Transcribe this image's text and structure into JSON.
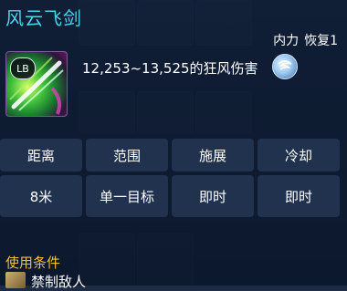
{
  "skill": {
    "name": "风云飞剑",
    "type_label": "内力",
    "recovery_label": "恢复1",
    "key": "LB",
    "icon": "wind-sword-skill-icon",
    "damage_text": "12,253~13,525的狂风伤害",
    "element_icon": "wind-element-icon"
  },
  "stats": {
    "headers": [
      "距离",
      "范围",
      "施展",
      "冷却"
    ],
    "values": [
      "8米",
      "单一目标",
      "即时",
      "即时"
    ]
  },
  "conditions": {
    "title": "使用条件",
    "items": [
      {
        "icon": "condition-icon",
        "text": "禁制敌人"
      }
    ]
  },
  "colors": {
    "title": "#4fd2ee",
    "condition_title": "#f0c032",
    "text": "#ffffff",
    "panel": "#0e1c34"
  }
}
